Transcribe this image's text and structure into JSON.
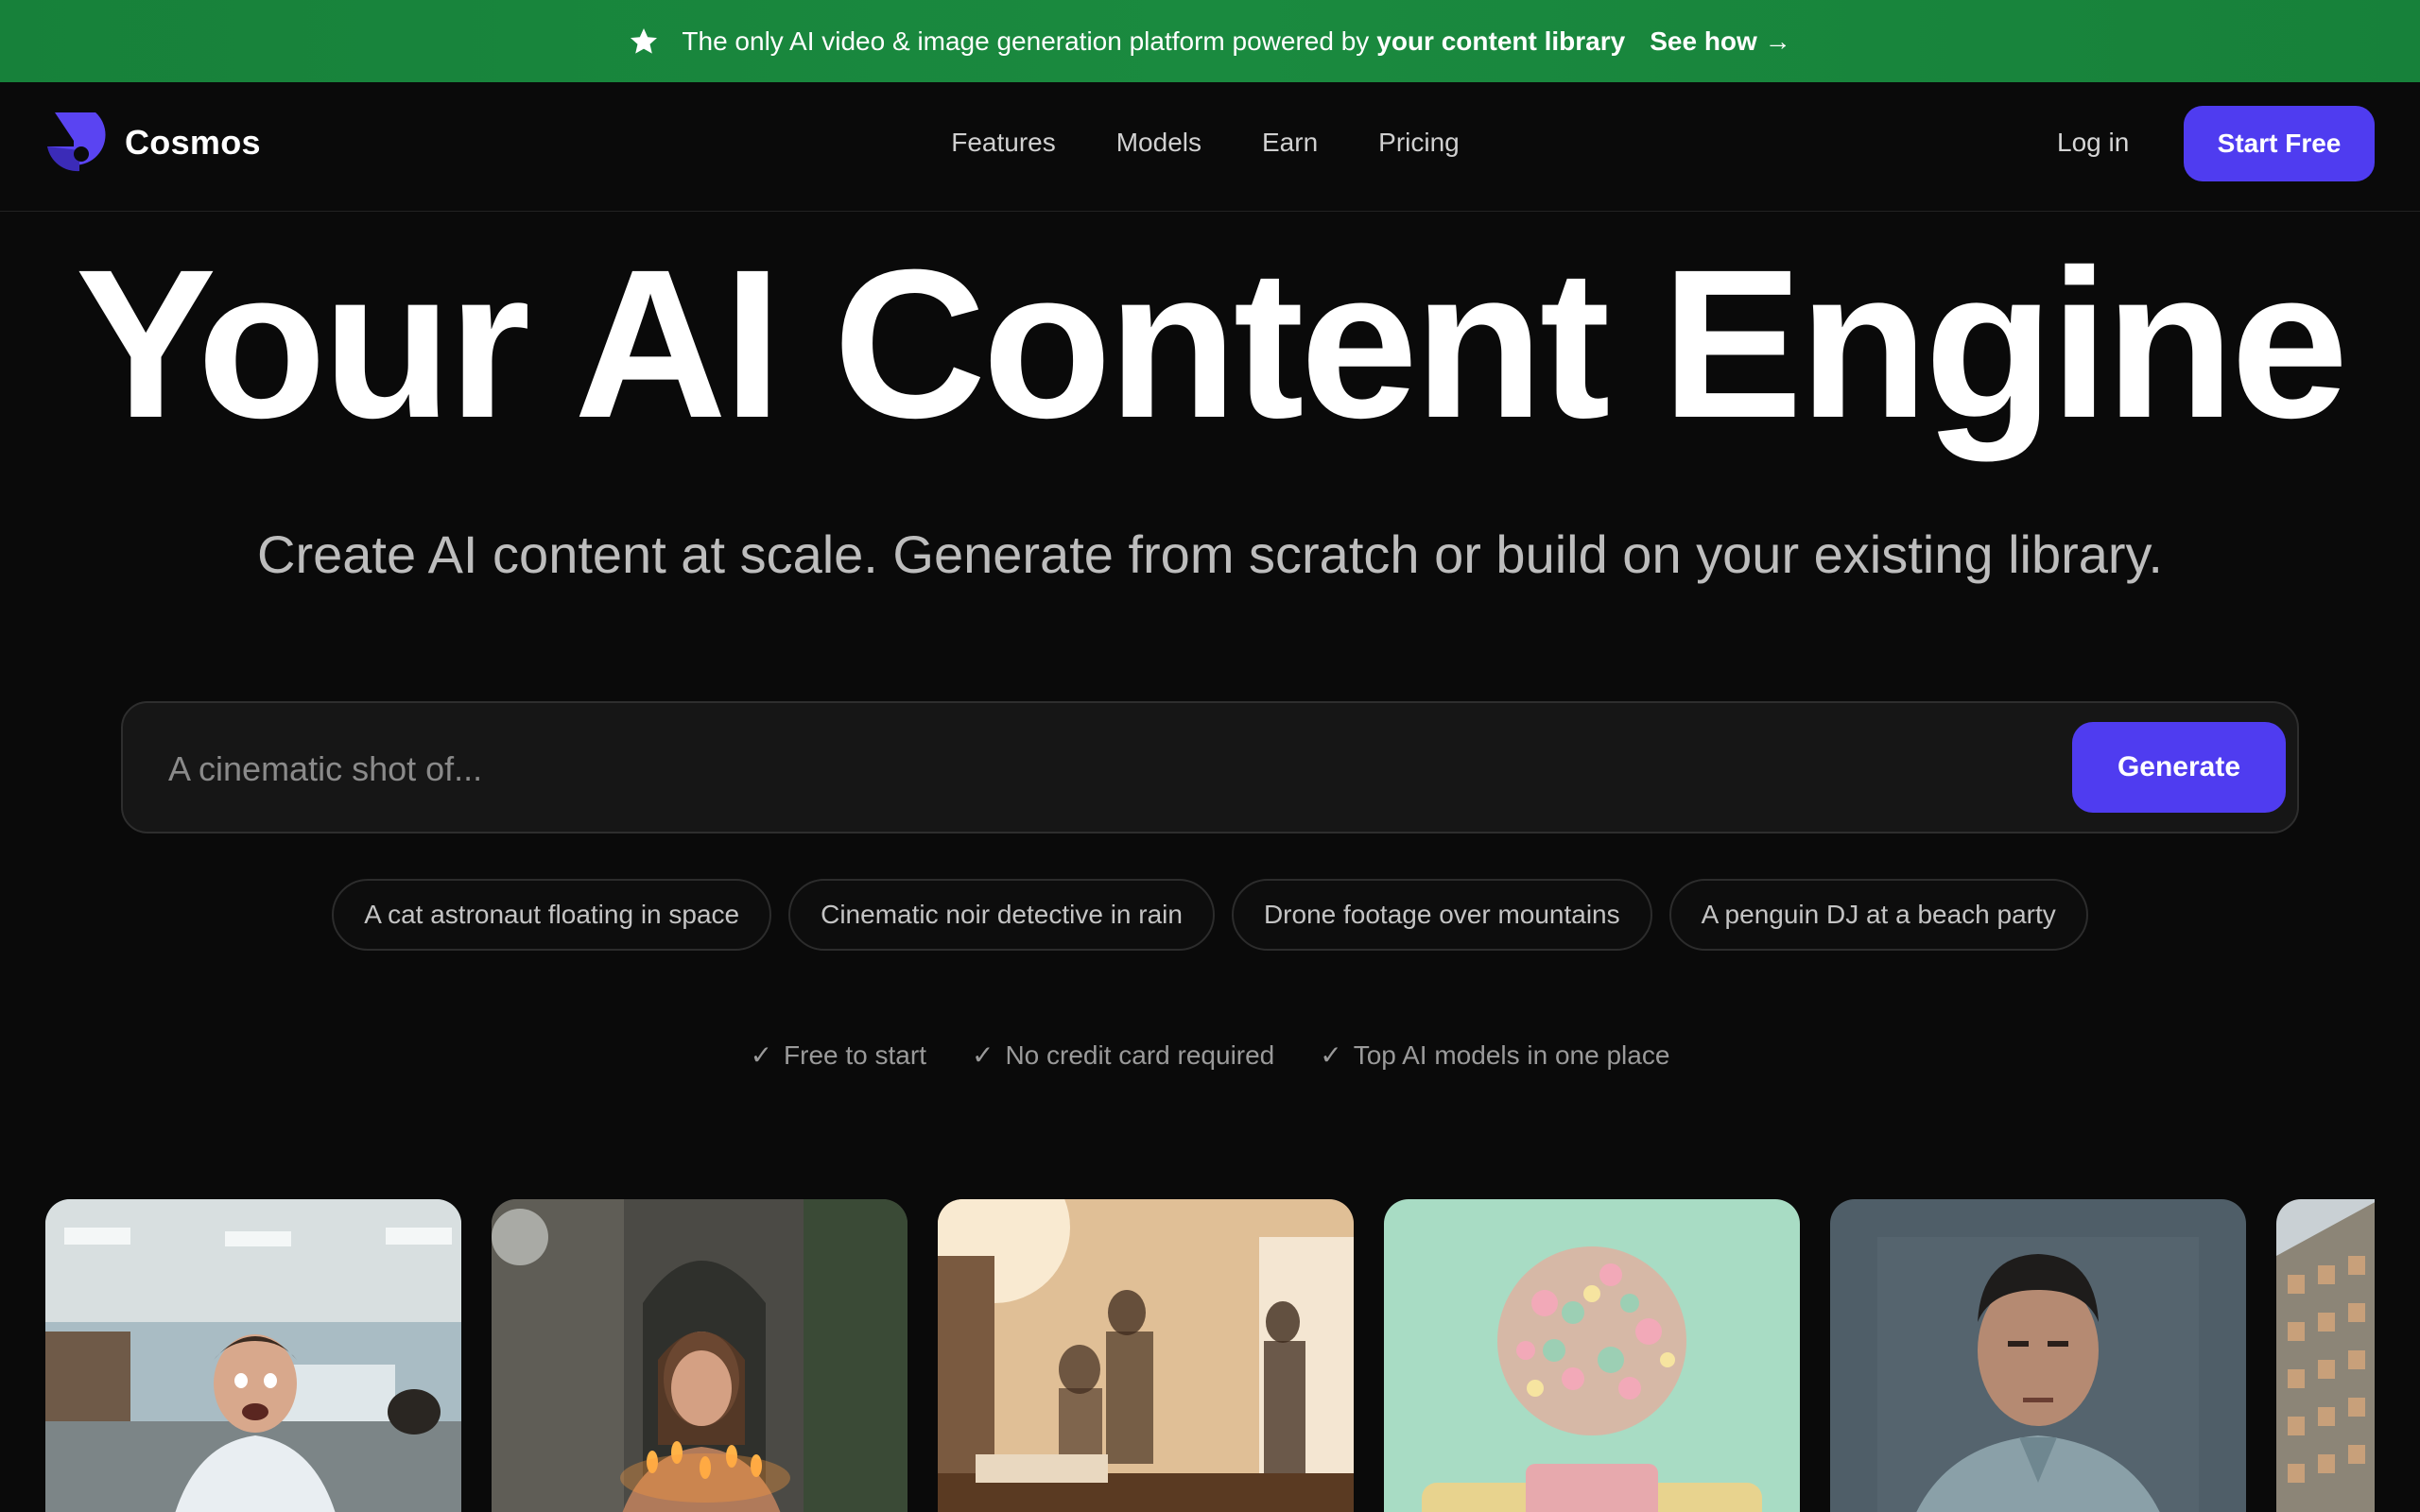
{
  "banner": {
    "text": "The only AI video & image generation platform powered by",
    "emphasis": "your content library",
    "link": "See how →",
    "icon": "star-icon"
  },
  "nav": {
    "brand": "Cosmos",
    "links": [
      "Features",
      "Models",
      "Earn",
      "Pricing"
    ],
    "login": "Log in",
    "cta": "Start Free"
  },
  "hero": {
    "title": "Your AI Content Engine",
    "subtitle": "Create AI content at scale. Generate from scratch or build on your existing library."
  },
  "prompt": {
    "placeholder": "A cinematic shot of...",
    "value": "",
    "button": "Generate"
  },
  "suggestions": [
    "A cat astronaut floating in space",
    "Cinematic noir detective in rain",
    "Drone footage over mountains",
    "A penguin DJ at a beach party"
  ],
  "benefits": [
    "Free to start",
    "No credit card required",
    "Top AI models in one place"
  ],
  "gallery": [
    {
      "subject": "office-worker-shocked"
    },
    {
      "subject": "woman-with-candles-in-ruins"
    },
    {
      "subject": "office-silhouettes-sunlight"
    },
    {
      "subject": "pastel-confetti-sphere"
    },
    {
      "subject": "stern-man-portrait"
    },
    {
      "subject": "apartment-building"
    }
  ],
  "colors": {
    "banner": "#17813a",
    "accent": "#4f3cf0",
    "background": "#0a0a0a"
  }
}
